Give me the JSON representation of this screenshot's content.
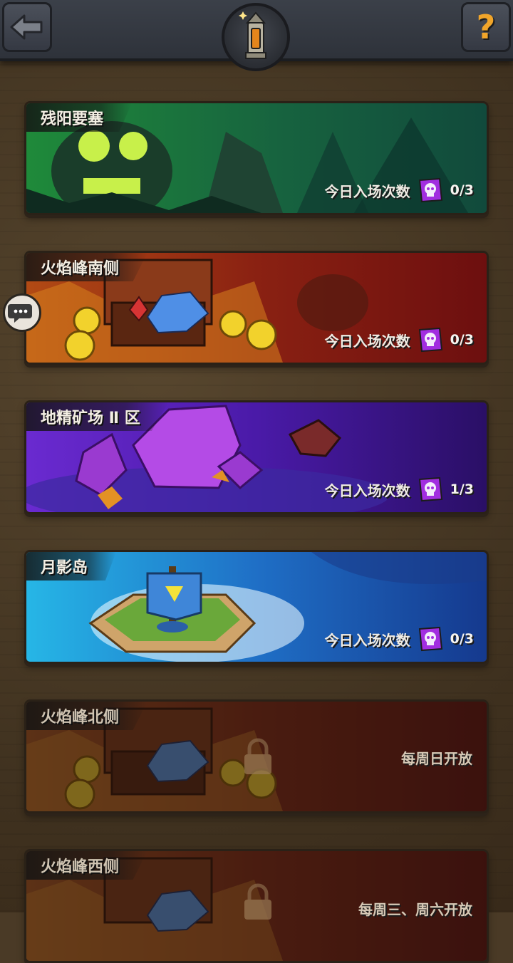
{
  "header": {
    "back_icon": "back-arrow-icon",
    "help_label": "?",
    "emblem_icon": "lantern-emblem-icon"
  },
  "chat_icon": "chat-bubble-icon",
  "entry_label": "今日入场次数",
  "dungeons": [
    {
      "name": "残阳要塞",
      "theme": "green",
      "entries": "0/3"
    },
    {
      "name": "火焰峰南侧",
      "theme": "fire",
      "entries": "0/3"
    },
    {
      "name": "地精矿场 Ⅱ 区",
      "theme": "purple",
      "entries": "1/3"
    },
    {
      "name": "月影岛",
      "theme": "ocean",
      "entries": "0/3"
    },
    {
      "name": "火焰峰北侧",
      "theme": "fire-locked",
      "status": "每周日开放"
    },
    {
      "name": "火焰峰西侧",
      "theme": "fire-locked",
      "status": "每周三、周六开放"
    }
  ],
  "colors": {
    "accent": "#f1a52a",
    "ticket": "#9b2bd6",
    "green": "#2aa54f",
    "fire": "#b32a12",
    "purple": "#6a2fc0",
    "ocean": "#1d4fa8"
  }
}
